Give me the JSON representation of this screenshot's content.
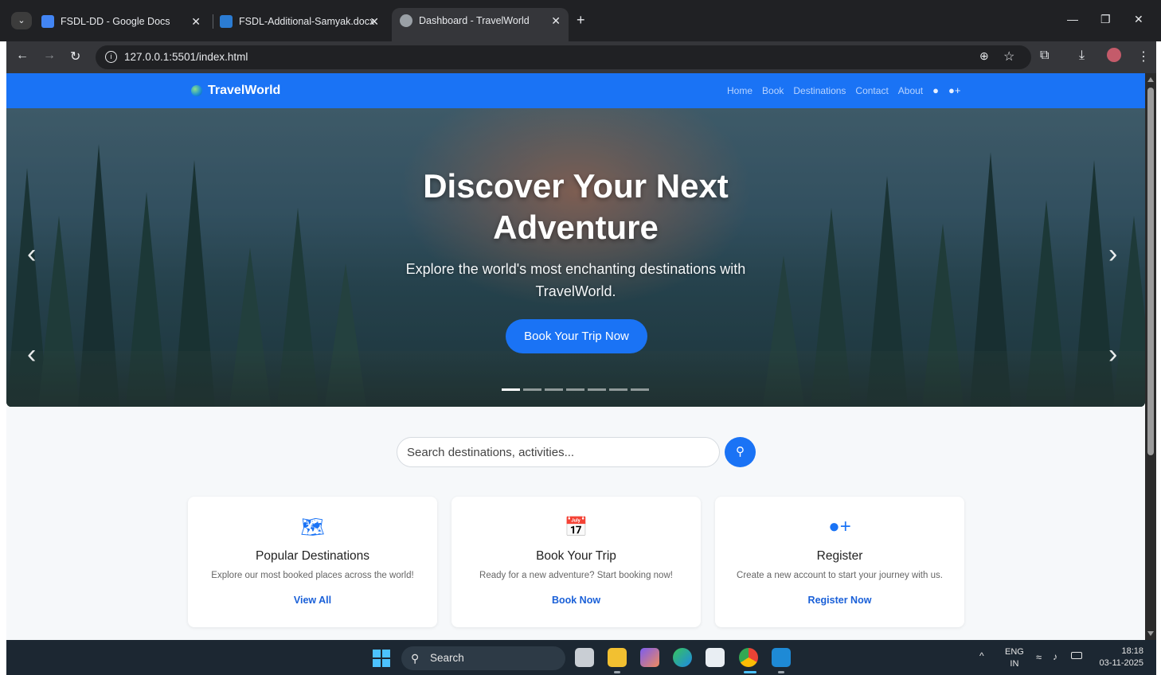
{
  "browser": {
    "tabs": [
      {
        "title": "FSDL-DD - Google Docs",
        "icon": "google-docs-icon",
        "color": "#4285f4"
      },
      {
        "title": "FSDL-Additional-Samyak.docx",
        "icon": "word-icon",
        "color": "#2b7cd3"
      },
      {
        "title": "Dashboard - TravelWorld",
        "icon": "globe-icon",
        "color": "#9aa0a6"
      }
    ],
    "new_tab": "+",
    "url": "127.0.0.1:5501/index.html"
  },
  "site": {
    "brand": "TravelWorld",
    "nav": [
      "Home",
      "Book",
      "Destinations",
      "Contact",
      "About"
    ],
    "nav_icons": [
      "user-icon",
      "user-plus-icon"
    ],
    "primary_color": "#1a73f5"
  },
  "hero": {
    "title": "Discover Your Next Adventure",
    "subtitle": "Explore the world's most enchanting destinations with TravelWorld.",
    "cta": "Book Your Trip Now",
    "prev": "‹",
    "next": "›",
    "slide_count": 7,
    "active_slide": 1
  },
  "search": {
    "placeholder": "Search destinations, activities...",
    "icon": "search-icon"
  },
  "cards": [
    {
      "icon": "map-icon",
      "title": "Popular Destinations",
      "desc": "Explore our most booked places across the world!",
      "link": "View All"
    },
    {
      "icon": "calendar-icon",
      "title": "Book Your Trip",
      "desc": "Ready for a new adventure? Start booking now!",
      "link": "Book Now"
    },
    {
      "icon": "user-plus-icon",
      "title": "Register",
      "desc": "Create a new account to start your journey with us.",
      "link": "Register Now"
    }
  ],
  "taskbar": {
    "search_label": "Search",
    "lang": "ENG",
    "region": "IN",
    "time": "18:18",
    "date": "03-11-2025"
  }
}
